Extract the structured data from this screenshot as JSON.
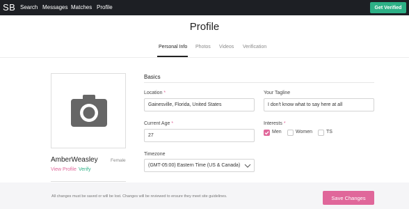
{
  "topbar": {
    "logo": "SB",
    "nav": [
      "Search",
      "Messages",
      "Matches",
      "Profile"
    ],
    "cta_label": "Get Verified",
    "cta_color": "#2db086"
  },
  "page": {
    "title": "Profile",
    "tabs": [
      {
        "label": "Personal Info",
        "active": true
      },
      {
        "label": "Photos",
        "active": false
      },
      {
        "label": "Videos",
        "active": false
      },
      {
        "label": "Verification",
        "active": false
      }
    ]
  },
  "profile_card": {
    "photo_icon": "camera-icon",
    "username": "AmberWeasley",
    "gender": "Female",
    "view_profile_label": "View Profile",
    "verify_label": "Verify"
  },
  "basics": {
    "title": "Basics",
    "location": {
      "label": "Location",
      "value": "Gainesville, Florida, United States"
    },
    "tagline": {
      "label": "Your Tagline",
      "value": "I don't know what to say here at all"
    },
    "age": {
      "label": "Current Age",
      "value": "27"
    },
    "interests": {
      "label": "Interests",
      "options": [
        {
          "label": "Men",
          "checked": true
        },
        {
          "label": "Women",
          "checked": false
        },
        {
          "label": "TS",
          "checked": false
        }
      ]
    },
    "timezone": {
      "label": "Timezone",
      "value": "(GMT-05:00) Eastern Time (US & Canada)"
    },
    "required_marker": "*"
  },
  "footer": {
    "note": "All changes must be saved or will be lost. Changes will be reviewed to ensure they meet site guidelines.",
    "save_label": "Save Changes"
  },
  "colors": {
    "accent": "#e0679a",
    "topbar_bg": "#1d1f24",
    "verify_green": "#2db086"
  }
}
